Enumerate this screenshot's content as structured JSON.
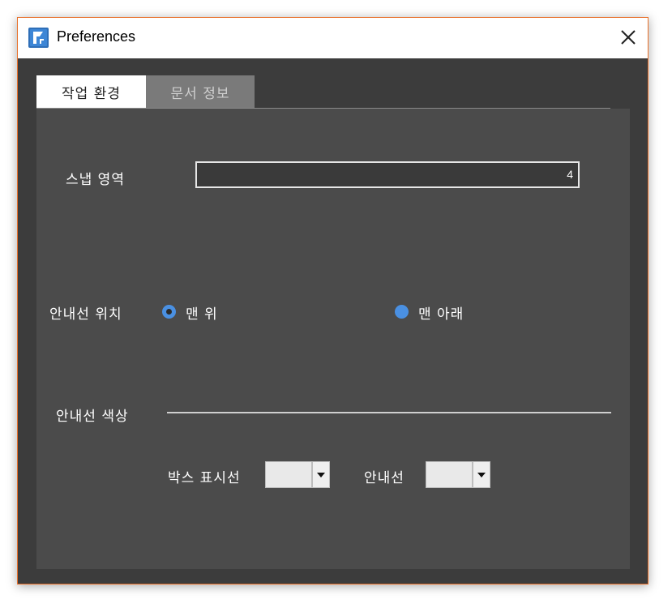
{
  "window": {
    "title": "Preferences",
    "icon": "app-logo-icon",
    "close_icon": "close-icon"
  },
  "tabs": [
    {
      "label": "작업 환경",
      "active": true
    },
    {
      "label": "문서 정보",
      "active": false
    }
  ],
  "snap": {
    "label": "스냅 영역",
    "value": "4"
  },
  "guide_position": {
    "label": "안내선 위치",
    "options": [
      {
        "label": "맨 위",
        "selected": true
      },
      {
        "label": "맨 아래",
        "selected": false
      }
    ]
  },
  "guide_color": {
    "label": "안내선 색상",
    "box_label": "박스 표시선",
    "guide_label": "안내선"
  },
  "colors": {
    "accent": "#4a90e2",
    "window_border": "#e8702a",
    "panel_bg": "#4b4b4b"
  }
}
